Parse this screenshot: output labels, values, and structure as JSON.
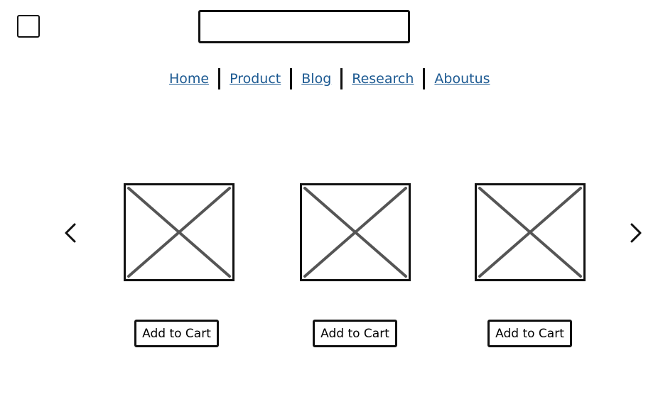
{
  "header": {
    "logo_icon": "square-logo-icon",
    "search": {
      "value": "",
      "placeholder": ""
    }
  },
  "nav": {
    "link_color": "#1d5a92",
    "items": [
      {
        "label": "Home"
      },
      {
        "label": "Product"
      },
      {
        "label": "Blog"
      },
      {
        "label": "Research"
      },
      {
        "label": "Aboutus"
      }
    ]
  },
  "carousel": {
    "prev_icon": "chevron-left-icon",
    "next_icon": "chevron-right-icon",
    "products": [
      {
        "image_icon": "image-placeholder-icon",
        "button_label": "Add to Cart"
      },
      {
        "image_icon": "image-placeholder-icon",
        "button_label": "Add to Cart"
      },
      {
        "image_icon": "image-placeholder-icon",
        "button_label": "Add to Cart"
      }
    ]
  }
}
